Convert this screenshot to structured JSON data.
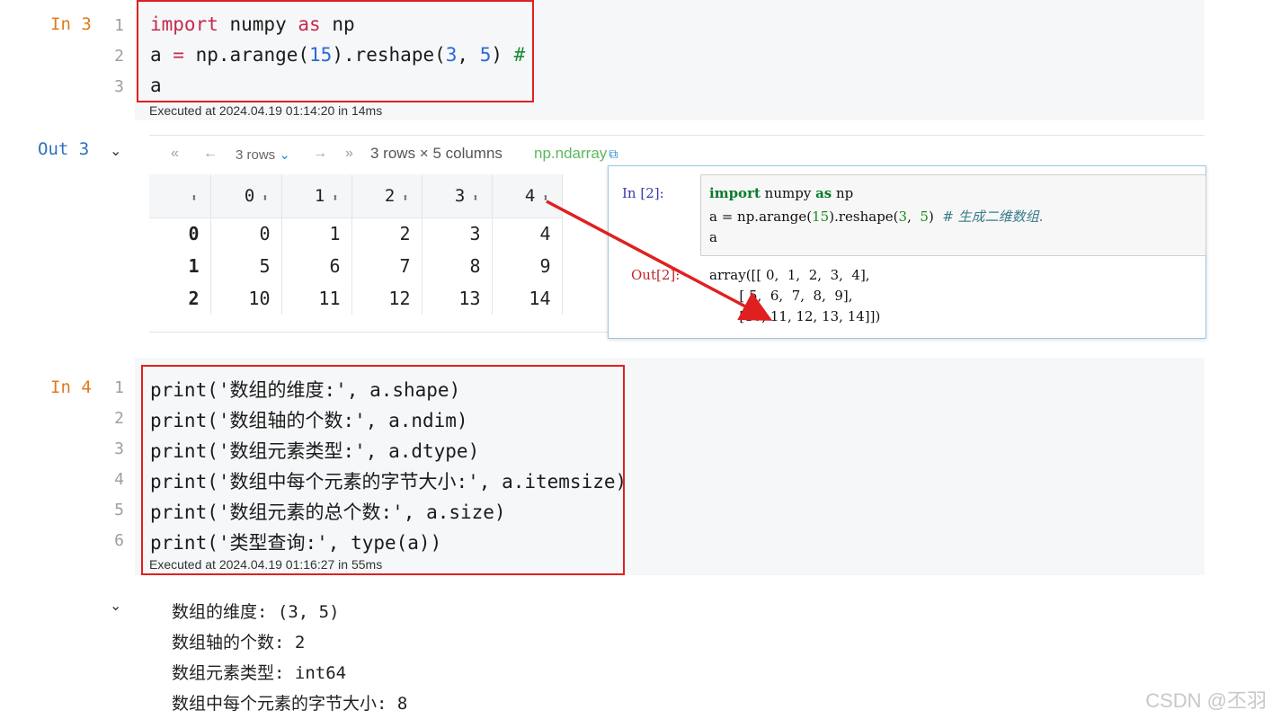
{
  "cell3": {
    "in_label": "In 3",
    "line_numbers": [
      "1",
      "2",
      "3"
    ],
    "code": [
      {
        "kw1": "import",
        "t1": " numpy ",
        "kw2": "as",
        "t2": " np"
      },
      {
        "a": "a ",
        "eq": "=",
        "b": " np.arange(",
        "n1": "15",
        "c": ").reshape(",
        "n2": "3",
        "d": ", ",
        "n3": "5",
        "e": ") ",
        "cmt": "#"
      },
      {
        "a": "a"
      }
    ],
    "exec_info": "Executed at 2024.04.19 01:14:20 in 14ms"
  },
  "out3": {
    "label": "Out 3",
    "nav": {
      "first": "«",
      "prev": "←",
      "rows_select": "3 rows",
      "next": "→",
      "last": "»",
      "summary": "3 rows × 5 columns",
      "type_link": "np.ndarray",
      "link_icon": "external-link-icon"
    },
    "table": {
      "columns": [
        "0",
        "1",
        "2",
        "3",
        "4"
      ],
      "rows": [
        {
          "index": "0",
          "cells": [
            "0",
            "1",
            "2",
            "3",
            "4"
          ]
        },
        {
          "index": "1",
          "cells": [
            "5",
            "6",
            "7",
            "8",
            "9"
          ]
        },
        {
          "index": "2",
          "cells": [
            "10",
            "11",
            "12",
            "13",
            "14"
          ]
        }
      ]
    }
  },
  "overlay": {
    "in_prompt": "In  [2]:",
    "out_prompt": "Out[2]:",
    "code": {
      "l1_kw1": "import",
      "l1_t": " numpy ",
      "l1_kw2": "as",
      "l1_t2": " np",
      "l2_a": "a = np.arange(",
      "l2_n1": "15",
      "l2_b": ").reshape(",
      "l2_n2": "3",
      "l2_c": ",  ",
      "l2_n3": "5",
      "l2_d": ")  ",
      "l2_cmt": "# 生成二维数组.",
      "l3": "a"
    },
    "output": [
      "array([[ 0,  1,  2,  3,  4],",
      "       [ 5,  6,  7,  8,  9],",
      "       [10, 11, 12, 13, 14]])"
    ]
  },
  "cell4": {
    "in_label": "In 4",
    "line_numbers": [
      "1",
      "2",
      "3",
      "4",
      "5",
      "6"
    ],
    "code": [
      "print('数组的维度:', a.shape)",
      "print('数组轴的个数:', a.ndim)",
      "print('数组元素类型:', a.dtype)",
      "print('数组中每个元素的字节大小:', a.itemsize)",
      "print('数组元素的总个数:', a.size)",
      "print('类型查询:', type(a))"
    ],
    "exec_info": "Executed at 2024.04.19 01:16:27 in 55ms"
  },
  "out4": {
    "lines": [
      "数组的维度: (3, 5)",
      "数组轴的个数: 2",
      "数组元素类型: int64",
      "数组中每个元素的字节大小: 8"
    ]
  },
  "watermark": "CSDN @丕羽",
  "colors": {
    "annotation_red": "#e02020",
    "prompt_in": "#e07b1f",
    "prompt_out": "#2f6fbf"
  }
}
